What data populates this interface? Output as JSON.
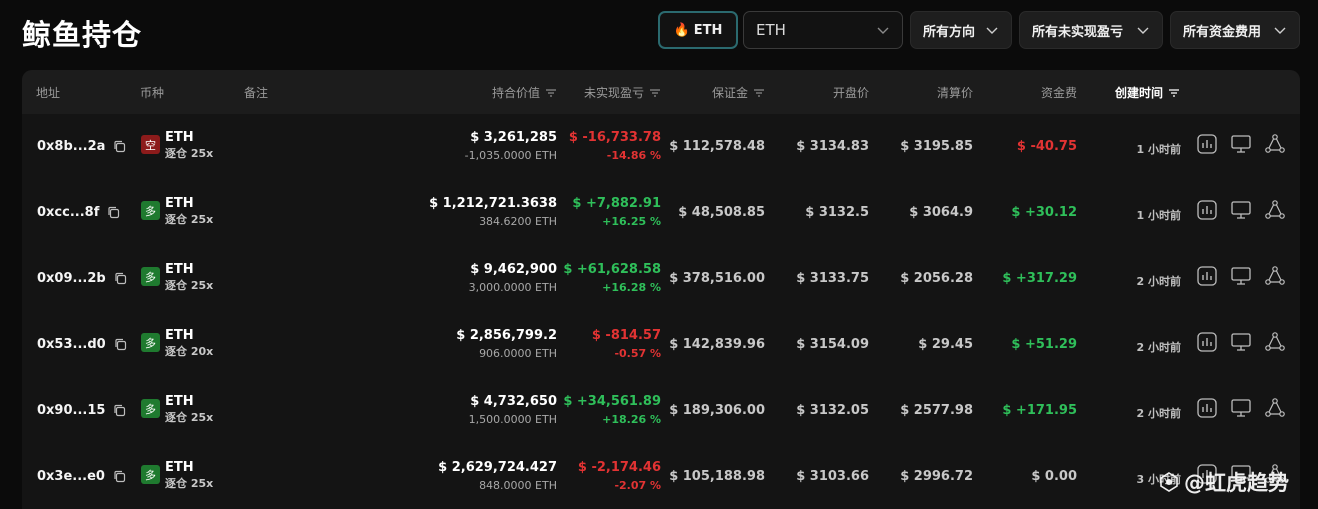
{
  "page": {
    "title": "鲸鱼持仓"
  },
  "filters": {
    "eth_chip": {
      "icon": "fire-icon",
      "label": "ETH"
    },
    "asset_select": {
      "value": "ETH"
    },
    "direction_select": {
      "value": "所有方向"
    },
    "pnl_select": {
      "value": "所有未实现盈亏"
    },
    "fee_select": {
      "value": "所有资金费用"
    }
  },
  "table": {
    "headers": {
      "address": "地址",
      "coin": "币种",
      "note": "备注",
      "position_value": "持合价值",
      "unrealized_pnl": "未实现盈亏",
      "margin": "保证金",
      "open_price": "开盘价",
      "liq_price": "清算价",
      "funding_fee": "资金费",
      "created_time": "创建时间"
    },
    "rows": [
      {
        "address": "0x8b...2a",
        "side_badge": "空",
        "side": "short",
        "coin": "ETH",
        "leverage": "逐仓 25x",
        "value": "$ 3,261,285",
        "size": "-1,035.0000 ETH",
        "pnl": "$ -16,733.78",
        "pnl_pct": "-14.86 %",
        "pnl_dir": "neg",
        "margin": "$ 112,578.48",
        "open_price": "$ 3134.83",
        "liq_price": "$ 3195.85",
        "funding": "$ -40.75",
        "funding_dir": "neg",
        "time": "1 小时前"
      },
      {
        "address": "0xcc...8f",
        "side_badge": "多",
        "side": "long",
        "coin": "ETH",
        "leverage": "逐仓 25x",
        "value": "$ 1,212,721.3638",
        "size": "384.6200 ETH",
        "pnl": "$ +7,882.91",
        "pnl_pct": "+16.25 %",
        "pnl_dir": "pos",
        "margin": "$ 48,508.85",
        "open_price": "$ 3132.5",
        "liq_price": "$ 3064.9",
        "funding": "$ +30.12",
        "funding_dir": "pos",
        "time": "1 小时前"
      },
      {
        "address": "0x09...2b",
        "side_badge": "多",
        "side": "long",
        "coin": "ETH",
        "leverage": "逐仓 25x",
        "value": "$ 9,462,900",
        "size": "3,000.0000 ETH",
        "pnl": "$ +61,628.58",
        "pnl_pct": "+16.28 %",
        "pnl_dir": "pos",
        "margin": "$ 378,516.00",
        "open_price": "$ 3133.75",
        "liq_price": "$ 2056.28",
        "funding": "$ +317.29",
        "funding_dir": "pos",
        "time": "2 小时前"
      },
      {
        "address": "0x53...d0",
        "side_badge": "多",
        "side": "long",
        "coin": "ETH",
        "leverage": "逐仓 20x",
        "value": "$ 2,856,799.2",
        "size": "906.0000 ETH",
        "pnl": "$ -814.57",
        "pnl_pct": "-0.57 %",
        "pnl_dir": "neg",
        "margin": "$ 142,839.96",
        "open_price": "$ 3154.09",
        "liq_price": "$ 29.45",
        "funding": "$ +51.29",
        "funding_dir": "pos",
        "time": "2 小时前"
      },
      {
        "address": "0x90...15",
        "side_badge": "多",
        "side": "long",
        "coin": "ETH",
        "leverage": "逐仓 25x",
        "value": "$ 4,732,650",
        "size": "1,500.0000 ETH",
        "pnl": "$ +34,561.89",
        "pnl_pct": "+18.26 %",
        "pnl_dir": "pos",
        "margin": "$ 189,306.00",
        "open_price": "$ 3132.05",
        "liq_price": "$ 2577.98",
        "funding": "$ +171.95",
        "funding_dir": "pos",
        "time": "2 小时前"
      },
      {
        "address": "0x3e...e0",
        "side_badge": "多",
        "side": "long",
        "coin": "ETH",
        "leverage": "逐仓 25x",
        "value": "$ 2,629,724.427",
        "size": "848.0000 ETH",
        "pnl": "$ -2,174.46",
        "pnl_pct": "-2.07 %",
        "pnl_dir": "neg",
        "margin": "$ 105,188.98",
        "open_price": "$ 3103.66",
        "liq_price": "$ 2996.72",
        "funding": "$ 0.00",
        "funding_dir": "neutral",
        "time": "3 小时前"
      }
    ],
    "row_actions": [
      "chart-icon",
      "monitor-icon",
      "share-network-icon"
    ]
  },
  "watermark": {
    "text": "@虹虎趋势"
  },
  "colors": {
    "positive": "#2fbf5a",
    "negative": "#e23333",
    "short_badge": "#8c1b1b",
    "long_badge": "#1f7a2f",
    "eth_chip_border": "#2b6a6f"
  }
}
